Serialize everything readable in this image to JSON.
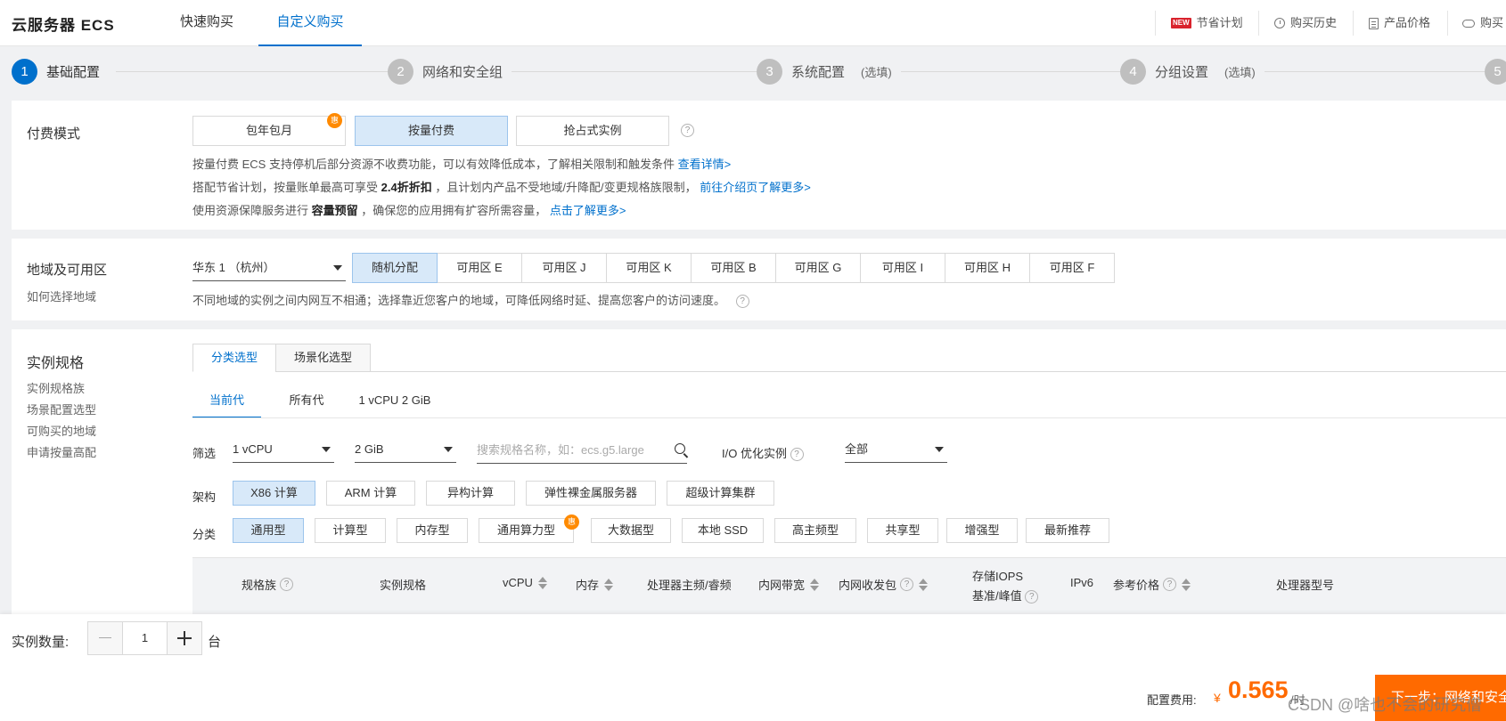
{
  "header": {
    "brand": "云服务器 ECS",
    "tabs": [
      "快速购买",
      "自定义购买"
    ],
    "links": [
      {
        "badge": "NEW",
        "label": "节省计划"
      },
      {
        "label": "购买历史"
      },
      {
        "label": "产品价格"
      },
      {
        "label": "购买"
      }
    ]
  },
  "steps": [
    {
      "num": "1",
      "label": "基础配置",
      "optional": ""
    },
    {
      "num": "2",
      "label": "网络和安全组",
      "optional": ""
    },
    {
      "num": "3",
      "label": "系统配置",
      "optional": "(选填)"
    },
    {
      "num": "4",
      "label": "分组设置",
      "optional": "(选填)"
    },
    {
      "num": "5",
      "label": "",
      "optional": ""
    }
  ],
  "billing": {
    "label": "付费模式",
    "options": [
      "包年包月",
      "按量付费",
      "抢占式实例"
    ],
    "selected": "按量付费",
    "badge": "惠",
    "help": "?",
    "line1_text": "按量付费 ECS 支持停机后部分资源不收费功能，可以有效降低成本，了解相关限制和触发条件",
    "line1_link": "查看详情>",
    "line2_pre": "搭配节省计划，按量账单最高可享受",
    "line2_bold": "2.4折折扣",
    "line2_post": "，且计划内产品不受地域/升降配/变更规格族限制，",
    "line2_link": "前往介绍页了解更多>",
    "line3_pre": "使用资源保障服务进行",
    "line3_bold": "容量预留",
    "line3_post": "，确保您的应用拥有扩容所需容量，",
    "line3_link": "点击了解更多>"
  },
  "region": {
    "label": "地域及可用区",
    "sublink": "如何选择地域",
    "selected_region": "华东 1 （杭州）",
    "zones": [
      "随机分配",
      "可用区 E",
      "可用区 J",
      "可用区 K",
      "可用区 B",
      "可用区 G",
      "可用区 I",
      "可用区 H",
      "可用区 F"
    ],
    "selected_zone": "随机分配",
    "hint": "不同地域的实例之间内网互不相通；选择靠近您客户的地域，可降低网络时延、提高您客户的访问速度。"
  },
  "instance": {
    "label": "实例规格",
    "sublinks": [
      "实例规格族",
      "场景配置选型",
      "可购买的地域",
      "申请按量高配"
    ],
    "mode_tabs": [
      "分类选型",
      "场景化选型"
    ],
    "gen_tabs": [
      "当前代",
      "所有代",
      "1 vCPU 2 GiB"
    ],
    "filter_label": "筛选",
    "vcpu": "1 vCPU",
    "memory": "2 GiB",
    "search_placeholder": "搜索规格名称，如：ecs.g5.large",
    "io_label": "I/O 优化实例",
    "io_value": "全部",
    "arch_label": "架构",
    "arch": [
      "X86 计算",
      "ARM 计算",
      "异构计算",
      "弹性裸金属服务器",
      "超级计算集群"
    ],
    "class_label": "分类",
    "classes": [
      "通用型",
      "计算型",
      "内存型",
      "通用算力型",
      "大数据型",
      "本地 SSD",
      "高主频型",
      "共享型",
      "增强型",
      "最新推荐"
    ],
    "class_badge": "惠",
    "columns": [
      "规格族",
      "实例规格",
      "vCPU",
      "内存",
      "处理器主频/睿频",
      "内网带宽",
      "内网收发包",
      "存储IOPS",
      "基准/峰值",
      "IPv6",
      "参考价格",
      "处理器型号"
    ]
  },
  "footer": {
    "qty_label": "实例数量:",
    "qty": "1",
    "unit": "台",
    "fee_label": "配置费用:",
    "currency": "¥",
    "price": "0.565",
    "per": "/时",
    "next": "下一步：网络和安全组",
    "watermark": "CSDN @啥也不会的研究僧"
  },
  "colors": {
    "accent": "#0070cc",
    "price": "#ff6a00",
    "selected_bg": "#d8e9f9",
    "badge": "#ff8a00"
  }
}
